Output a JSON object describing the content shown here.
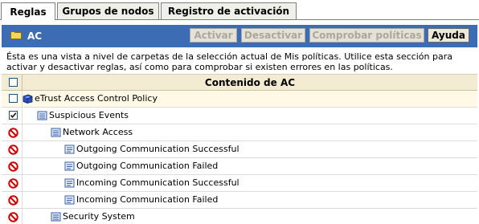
{
  "tabs": [
    {
      "label": "Reglas",
      "active": true
    },
    {
      "label": "Grupos de nodos",
      "active": false
    },
    {
      "label": "Registro de activación",
      "active": false
    }
  ],
  "header": {
    "title": "AC",
    "buttons": [
      {
        "label": "Activar",
        "enabled": false
      },
      {
        "label": "Desactivar",
        "enabled": false
      },
      {
        "label": "Comprobar políticas",
        "enabled": false
      },
      {
        "label": "Ayuda",
        "enabled": true
      }
    ]
  },
  "description": "Ésta es una vista a nivel de carpetas de la selección actual de Mis políticas. Utilice esta sección para activar y desactivar reglas, así como para comprobar si existen errores en las políticas.",
  "table": {
    "header": "Contenido de AC",
    "rows": [
      {
        "label": "eTrust Access Control Policy",
        "icon": "policy-book-icon",
        "status": "checkbox",
        "checked": false,
        "level": 0
      },
      {
        "label": "Suspicious Events",
        "icon": "folder-list-icon",
        "status": "checkbox",
        "checked": true,
        "level": 1
      },
      {
        "label": "Network Access",
        "icon": "folder-list-icon",
        "status": "disabled",
        "level": 2
      },
      {
        "label": "Outgoing Communication Successful",
        "icon": "rule-list-icon",
        "status": "disabled",
        "level": 3
      },
      {
        "label": "Outgoing Communication Failed",
        "icon": "rule-list-icon",
        "status": "disabled",
        "level": 3
      },
      {
        "label": "Incoming Communication Successful",
        "icon": "rule-list-icon",
        "status": "disabled",
        "level": 3
      },
      {
        "label": "Incoming Communication Failed",
        "icon": "rule-list-icon",
        "status": "disabled",
        "level": 3
      },
      {
        "label": "Security System",
        "icon": "folder-list-icon",
        "status": "disabled",
        "level": 2
      }
    ]
  },
  "colors": {
    "header_bg": "#3c6db4",
    "table_header_bg": "#f3ecd2",
    "disabled_icon": "#cc0000"
  }
}
